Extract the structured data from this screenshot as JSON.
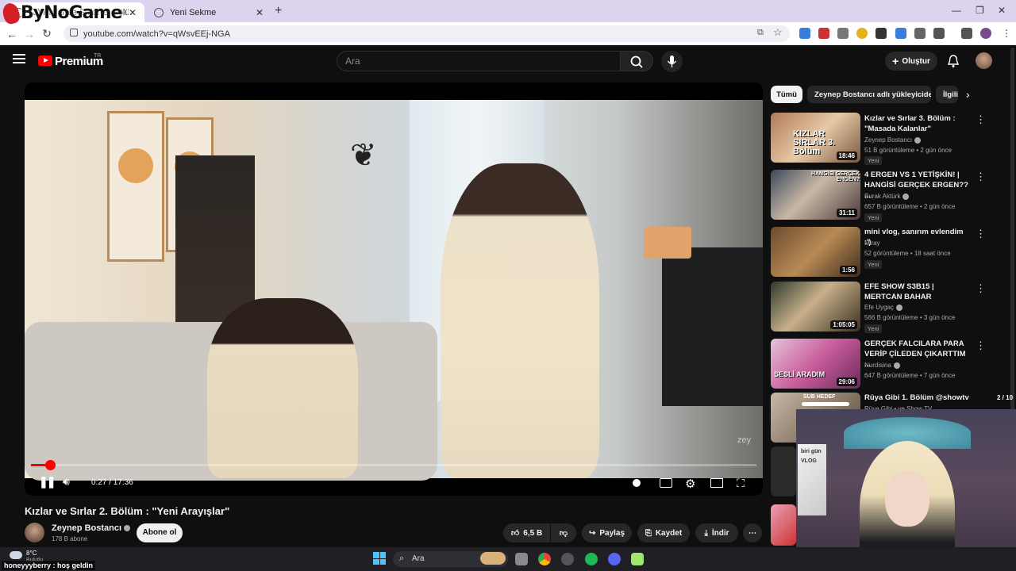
{
  "browser": {
    "tabs": [
      {
        "label": "(3) Kızlar ve Sırlar 2. Bölüm : \"Yeni Arayışlar\" - YouTube",
        "active": true
      },
      {
        "label": "Yeni Sekme",
        "active": false
      }
    ],
    "url": "youtube.com/watch?v=qWsvEEj-NGA",
    "overlay_logo": "ByNoGame"
  },
  "header": {
    "brand": "Premium",
    "region": "TR",
    "search_placeholder": "Ara",
    "create_label": "Oluştur"
  },
  "player": {
    "time": "0:27 / 17:36",
    "progress_fraction": 0.026,
    "watermark": "zey"
  },
  "video": {
    "title": "Kızlar ve Sırlar 2. Bölüm : \"Yeni Arayışlar\"",
    "channel": "Zeynep Bostancı",
    "subscribers": "178 B abone",
    "subscribe_label": "Abone ol",
    "likes": "6,5 B",
    "share_label": "Paylaş",
    "save_label": "Kaydet",
    "download_label": "İndir"
  },
  "chips": [
    "Tümü",
    "Zeynep Bostancı adlı yükleyiciden",
    "İlgili"
  ],
  "recommendations": [
    {
      "title": "Kızlar ve Sırlar 3. Bölüm : \"Masada Kalanlar\"",
      "channel": "Zeynep Bostancı",
      "meta": "51 B görüntüleme • 2 gün önce",
      "badge": "Yeni",
      "duration": "18:46",
      "thumb_text": "KIZLAR SIRLAR 3. Bölüm"
    },
    {
      "title": "4 ERGEN VS 1 YETİŞKİN! | HANGİSİ GERÇEK ERGEN?? ...",
      "channel": "Burak Aktürk",
      "meta": "657 B görüntüleme • 2 gün önce",
      "badge": "Yeni",
      "duration": "31:11",
      "thumb_text": "HANGİSİ GERÇEK ERGEN?"
    },
    {
      "title": "mini vlog, sanırım evlendim :')",
      "channel": "Miray",
      "meta": "52 görüntüleme • 18 saat önce",
      "badge": "Yeni",
      "duration": "1:56",
      "thumb_text": ""
    },
    {
      "title": "EFE SHOW S3B15 | MERTCAN BAHAR",
      "channel": "Efe Uygaç",
      "meta": "566 B görüntüleme • 3 gün önce",
      "badge": "Yeni",
      "duration": "1:05:05",
      "thumb_text": ""
    },
    {
      "title": "GERÇEK FALCILARA PARA VERİP ÇİLEDEN ÇIKARTTIM ...",
      "channel": "Nurdisina",
      "meta": "647 B görüntüleme • 7 gün önce",
      "badge": "",
      "duration": "29:06",
      "thumb_text": "SESLİ ARADIM"
    },
    {
      "title": "Rüya Gibi 1. Bölüm @showtv",
      "channel": "Rüya Gibi • ve Show TV",
      "meta": "",
      "badge": "",
      "duration": "",
      "thumb_text": ""
    }
  ],
  "stream_overlay": {
    "sub_goal_label": "SUB HEDEF",
    "sub_goal_count": "2 / 10",
    "chat_message": "honeyyyberry : hoş geldin",
    "thumb_text": "biri gün VLOG"
  },
  "taskbar": {
    "weather_temp": "8°C",
    "weather_desc": "Bulutlu",
    "search_placeholder": "Ara"
  },
  "colors": {
    "accent": "#ff0000",
    "background": "#0f0f0f",
    "chip_bg": "#272727"
  }
}
